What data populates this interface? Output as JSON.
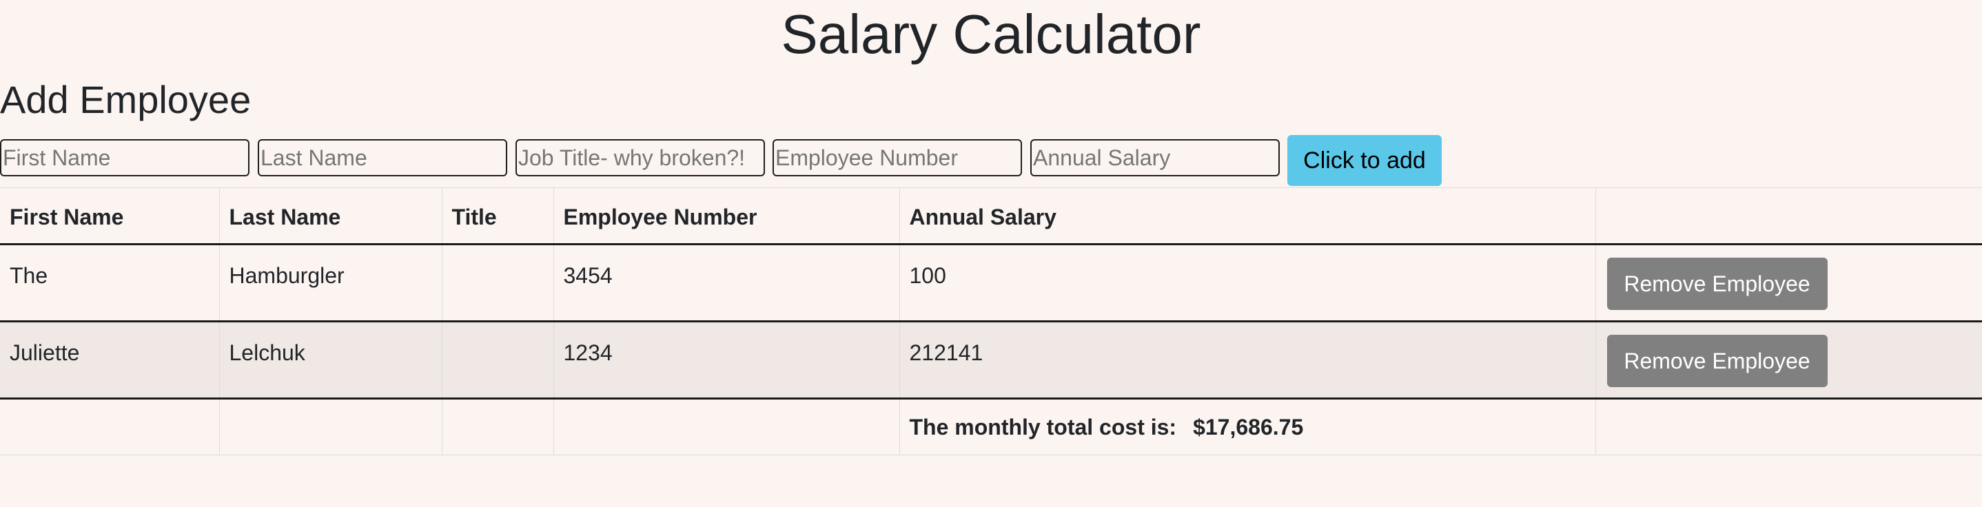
{
  "page": {
    "title": "Salary Calculator"
  },
  "form": {
    "heading": "Add Employee",
    "first_name_placeholder": "First Name",
    "last_name_placeholder": "Last Name",
    "job_title_placeholder": "Job Title- why broken?!",
    "employee_number_placeholder": "Employee Number",
    "annual_salary_placeholder": "Annual Salary",
    "first_name_value": "",
    "last_name_value": "",
    "job_title_value": "",
    "employee_number_value": "",
    "annual_salary_value": "",
    "add_label": "Click to add",
    "add_button_color": "#5bc8ea"
  },
  "table": {
    "columns": [
      "First Name",
      "Last Name",
      "Title",
      "Employee Number",
      "Annual Salary",
      ""
    ],
    "rows": [
      {
        "first_name": "The",
        "last_name": "Hamburgler",
        "title": "",
        "employee_number": "3454",
        "annual_salary": "100",
        "remove_label": "Remove Employee"
      },
      {
        "first_name": "Juliette",
        "last_name": "Lelchuk",
        "title": "",
        "employee_number": "1234",
        "annual_salary": "212141",
        "remove_label": "Remove Employee"
      }
    ],
    "total": {
      "label": "The monthly total cost is:",
      "value": "$17,686.75"
    },
    "remove_button_color": "#808080"
  },
  "colors": {
    "background": "#fcf4f0",
    "striped_row": "#efe8e4"
  }
}
